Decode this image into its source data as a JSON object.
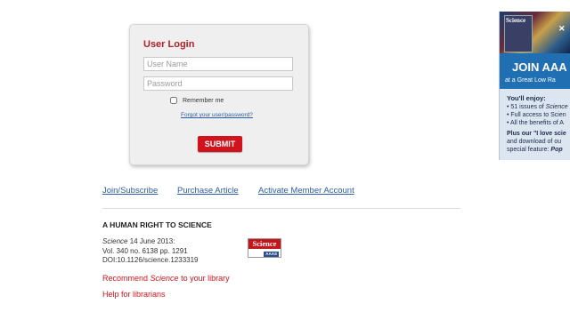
{
  "login": {
    "title": "User Login",
    "username_placeholder": "User Name",
    "password_placeholder": "Password",
    "remember_label": "Remember me",
    "forgot_label": "Forgot your user/password?",
    "submit_label": "SUBMIT"
  },
  "links": {
    "join": "Join/Subscribe",
    "purchase": "Purchase Article",
    "activate": "Activate Member Account"
  },
  "article": {
    "title": "A HUMAN RIGHT TO SCIENCE",
    "journal": "Science",
    "date": "14 June 2013:",
    "volume": "Vol. 340 no. 6138 pp. 1291",
    "doi": "DOI:10.1126/science.1233319",
    "logo_text": "Science",
    "logo_sub": "AAAS"
  },
  "actions": {
    "recommend_prefix": "Recommend ",
    "recommend_em": "Science",
    "recommend_suffix": " to your library",
    "help": "Help for librarians"
  },
  "ad": {
    "mag_title": "Science",
    "join": "JOIN AAA",
    "sub": "at a Great Low Ra",
    "enjoy": "You'll enjoy:",
    "b1_prefix": "• 51 issues of ",
    "b1_em": "Science",
    "b2": "• Full access to Scien",
    "b3": "• All the benefits of A",
    "plus_prefix": "Plus our ",
    "plus_quote": "\"I love scie",
    "line2": "and download of ou",
    "line3_prefix": "special feature: ",
    "line3_em": "Pop"
  },
  "colors": {
    "accent_red": "#d0131c",
    "link_blue": "#2a5da8",
    "title_red": "#b0202a"
  }
}
